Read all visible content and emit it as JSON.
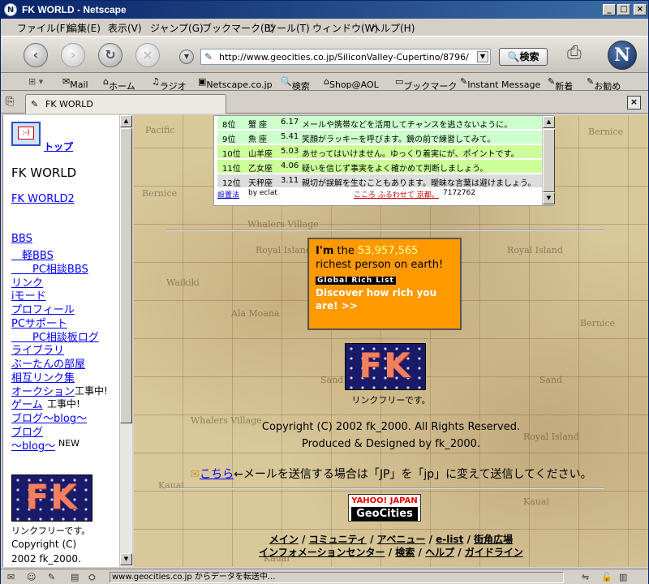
{
  "window": {
    "title": "FK WORLD - Netscape",
    "app_icon": "netscape-icon",
    "controls": [
      "minimize",
      "maximize",
      "close"
    ]
  },
  "menu": {
    "items": [
      "ファイル(F)",
      "編集(E)",
      "表示(V)",
      "ジャンプ(G)",
      "ブックマーク(B)",
      "ツール(T)",
      "ウィンドウ(W)",
      "ヘルプ(H)"
    ]
  },
  "nav": {
    "url": "http://www.geocities.co.jp/SiliconValley-Cupertino/8796/",
    "search_label": "検索",
    "logo_letter": "N"
  },
  "personal_toolbar": {
    "items": [
      "Mail",
      "ホーム",
      "ラジオ",
      "Netscape.co.jp",
      "検索",
      "Shop@AOL",
      "ブックマーク",
      "Instant Message",
      "新着",
      "お勧め"
    ]
  },
  "tab": {
    "title": "FK WORLD"
  },
  "sidebar": {
    "top_link": "トップ",
    "site_title": "FK WORLD",
    "world2_link": "FK WORLD2",
    "links": [
      {
        "label": "BBS",
        "suffix": ""
      },
      {
        "label": "　軽BBS",
        "suffix": ""
      },
      {
        "label": "　　PC相談BBS",
        "suffix": ""
      },
      {
        "label": "リンク",
        "suffix": ""
      },
      {
        "label": "iモード",
        "suffix": ""
      },
      {
        "label": "プロフィール",
        "suffix": ""
      },
      {
        "label": "PCサポート",
        "suffix": ""
      },
      {
        "label": "　　PC相談板ログ",
        "suffix": ""
      },
      {
        "label": "ライブラリ",
        "suffix": ""
      },
      {
        "label": "ぶーたんの部屋",
        "suffix": ""
      },
      {
        "label": "相互リンク集",
        "suffix": ""
      },
      {
        "label": "オークション",
        "suffix": "工事中!"
      },
      {
        "label": "ゲーム",
        "suffix": "工事中!"
      },
      {
        "label": "ブログ～blog～",
        "suffix": ""
      },
      {
        "label": "ブログ",
        "suffix": ""
      },
      {
        "label": "～blog～",
        "suffix": "NEW"
      }
    ],
    "banner_text": "FK",
    "link_free": "リンクフリーです。",
    "copyright_1": "Copyright (C)",
    "copyright_2": "2002 fk_2000."
  },
  "fortune": {
    "rows": [
      {
        "rank": "8位",
        "sign": "蟹 座",
        "score": "6.17",
        "text": "メールや携帯などを活用してチャンスを逃さないように。",
        "color": "#ccffcc"
      },
      {
        "rank": "9位",
        "sign": "魚 座",
        "score": "5.41",
        "text": "笑顔がラッキーを呼びます。鏡の前で練習してみて。",
        "color": "#ccffcc"
      },
      {
        "rank": "10位",
        "sign": "山羊座",
        "score": "5.03",
        "text": "あせってはいけません。ゆっくり着実にが、ポイントです。",
        "color": "#ccff99"
      },
      {
        "rank": "11位",
        "sign": "乙女座",
        "score": "4.06",
        "text": "疑いを信じず事実をよく確かめて判断しましょう。",
        "color": "#ccff99"
      },
      {
        "rank": "12位",
        "sign": "天秤座",
        "score": "3.11",
        "text": "親切が誤解を生むこともあります。曖昧な言葉は避けましょう。",
        "color": "#dddddd"
      }
    ],
    "setup_link": "設置法",
    "by": "by eclat",
    "ad_link": "こころ ふるわせて 京都。",
    "counter": "7172762"
  },
  "rich": {
    "im": "I'm",
    "the": " the ",
    "number": "53,957,565",
    "rest": " richest person on earth!",
    "tag": "Global Rich List",
    "discover": "Discover how rich you are! >>"
  },
  "main": {
    "banner_text": "FK",
    "link_free": "リンクフリーです。",
    "copyright": "Copyright (C) 2002 fk_2000. All Rights Reserved.",
    "produced": "Produced & Designed by fk_2000.",
    "mail_link": "こちら",
    "mail_note": "←メールを送信する場合は「JP」を「jp」に変えて送信してください。",
    "geo_yahoo": "YAHOO! JAPAN",
    "geo_name": "GeoCities",
    "footer_row1": [
      "メイン",
      "コミュニティ",
      "アベニュー",
      "e-list",
      "街角広場"
    ],
    "footer_row2": [
      "インフォメーションセンター",
      "検索",
      "ヘルプ",
      "ガイドライン"
    ]
  },
  "status": {
    "text": "www.geocities.co.jp からデータを転送中..."
  }
}
